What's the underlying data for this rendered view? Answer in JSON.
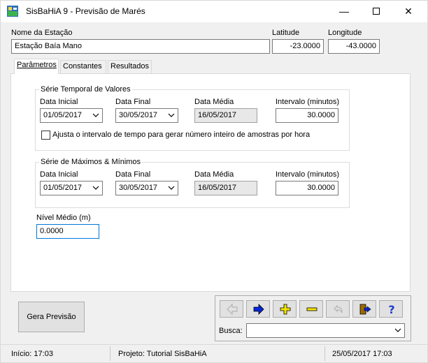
{
  "window": {
    "title": "SisBaHiA 9 - Previsão de Marés",
    "minimize_glyph": "—",
    "close_glyph": "✕"
  },
  "station": {
    "name_label": "Nome da Estação",
    "name_value": "Estação Baía Mano",
    "latitude_label": "Latitude",
    "latitude_value": "-23.0000",
    "longitude_label": "Longitude",
    "longitude_value": "-43.0000"
  },
  "tabs": [
    {
      "label": "Parâmetros",
      "active": true
    },
    {
      "label": "Constantes",
      "active": false
    },
    {
      "label": "Resultados",
      "active": false
    }
  ],
  "serie_temporal": {
    "title": "Série Temporal de Valores",
    "data_inicial_label": "Data Inicial",
    "data_inicial_value": "01/05/2017",
    "data_final_label": "Data Final",
    "data_final_value": "30/05/2017",
    "data_media_label": "Data Média",
    "data_media_value": "16/05/2017",
    "intervalo_label": "Intervalo (minutos)",
    "intervalo_value": "30.0000",
    "checkbox_label": "Ajusta o intervalo de tempo para gerar número inteiro de amostras por hora",
    "checkbox_checked": false
  },
  "serie_maxmin": {
    "title": "Série de Máximos & Mínimos",
    "data_inicial_label": "Data Inicial",
    "data_inicial_value": "01/05/2017",
    "data_final_label": "Data Final",
    "data_final_value": "30/05/2017",
    "data_media_label": "Data Média",
    "data_media_value": "16/05/2017",
    "intervalo_label": "Intervalo (minutos)",
    "intervalo_value": "30.0000"
  },
  "nivel_medio": {
    "label": "Nível Médio (m)",
    "value": "0.0000"
  },
  "actions": {
    "gera_previsao_label": "Gera Previsão",
    "busca_label": "Busca:",
    "busca_value": ""
  },
  "toolbar_icons": [
    "arrow-left-icon",
    "arrow-right-icon",
    "plus-icon",
    "minus-icon",
    "undo-icon",
    "exit-door-icon",
    "help-icon"
  ],
  "colors": {
    "arrow_blue": "#0026d9",
    "plus_yellow": "#f5e400",
    "help_blue": "#1f3ecb",
    "disabled_gray": "#b5b5b5"
  },
  "status": {
    "inicio": "Início: 17:03",
    "projeto": "Projeto: Tutorial SisBaHiA",
    "datetime": "25/05/2017 17:03"
  }
}
